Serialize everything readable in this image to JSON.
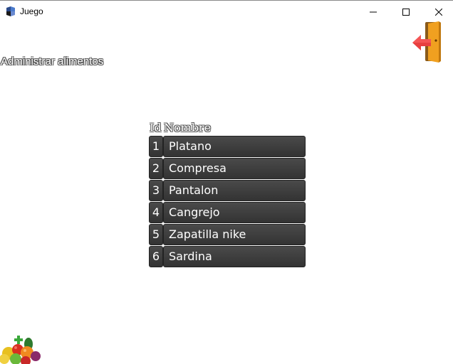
{
  "window": {
    "title": "Juego",
    "controls": {
      "minimize": "minimize-icon",
      "maximize": "maximize-icon",
      "close": "close-icon"
    }
  },
  "header": {
    "title": "Administrar alimentos",
    "exit_icon": "exit-door-icon"
  },
  "table": {
    "columns": [
      "Id",
      "Nombre"
    ],
    "rows": [
      {
        "id": "1",
        "name": "Platano"
      },
      {
        "id": "2",
        "name": "Compresa"
      },
      {
        "id": "3",
        "name": "Pantalon"
      },
      {
        "id": "4",
        "name": "Cangrejo"
      },
      {
        "id": "5",
        "name": "Zapatilla nike"
      },
      {
        "id": "6",
        "name": "Sardina"
      }
    ]
  },
  "footer": {
    "logo_icon": "fruit-basket-icon"
  },
  "colors": {
    "row_bg": "#3a3a3a",
    "door_orange": "#f0a020",
    "arrow_red": "#e84040"
  }
}
